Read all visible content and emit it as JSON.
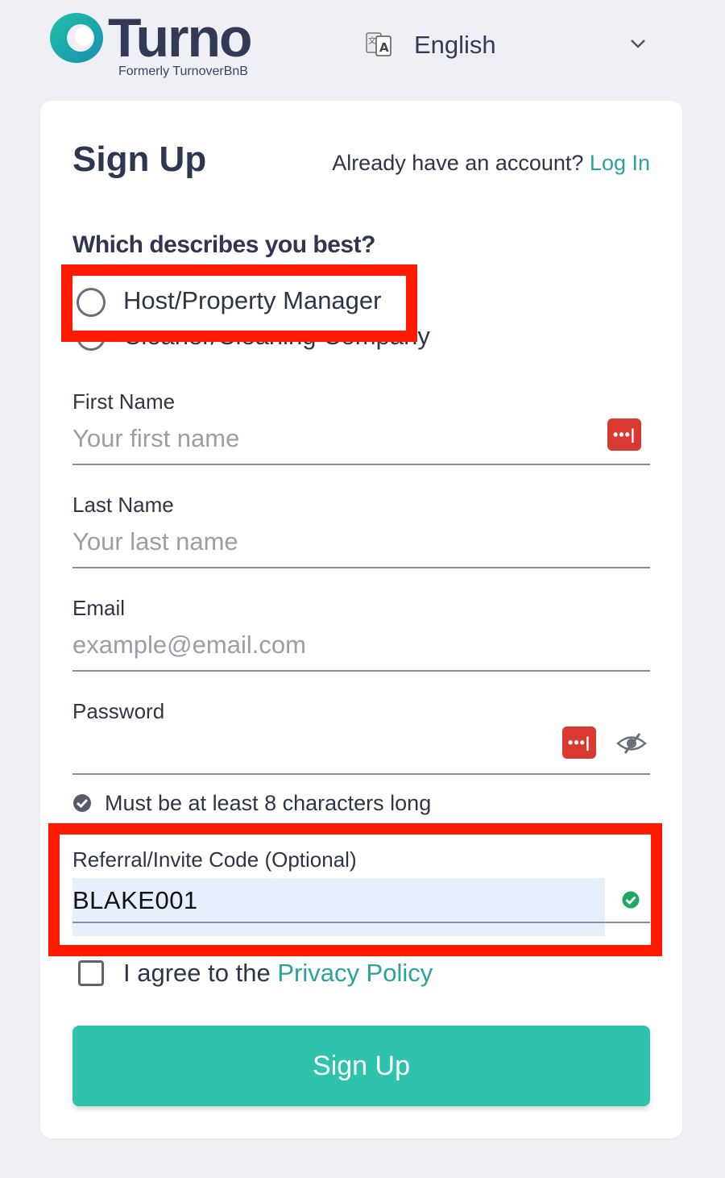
{
  "header": {
    "logo_word": "Turno",
    "logo_sub": "Formerly TurnoverBnB",
    "language": "English"
  },
  "card": {
    "title": "Sign Up",
    "already_text": "Already have an account?",
    "login_link": "Log In",
    "question": "Which describes you best?",
    "roles": [
      {
        "label": "Host/Property Manager"
      },
      {
        "label": "Cleaner/Cleaning Company"
      }
    ],
    "first_name": {
      "label": "First Name",
      "placeholder": "Your first name"
    },
    "last_name": {
      "label": "Last Name",
      "placeholder": "Your last name"
    },
    "email": {
      "label": "Email",
      "placeholder": "example@email.com"
    },
    "password": {
      "label": "Password"
    },
    "password_hint": "Must be at least 8 characters long",
    "referral": {
      "label": "Referral/Invite Code (Optional)",
      "value": "BLAKE001"
    },
    "agree_text": "I agree to the",
    "privacy_link": "Privacy Policy",
    "submit": "Sign Up",
    "password_manager_badge": "•••|"
  },
  "colors": {
    "accent": "#2fc2ad",
    "link": "#2aa39a",
    "highlight": "#ff1a00",
    "password_manager": "#d83a32"
  }
}
